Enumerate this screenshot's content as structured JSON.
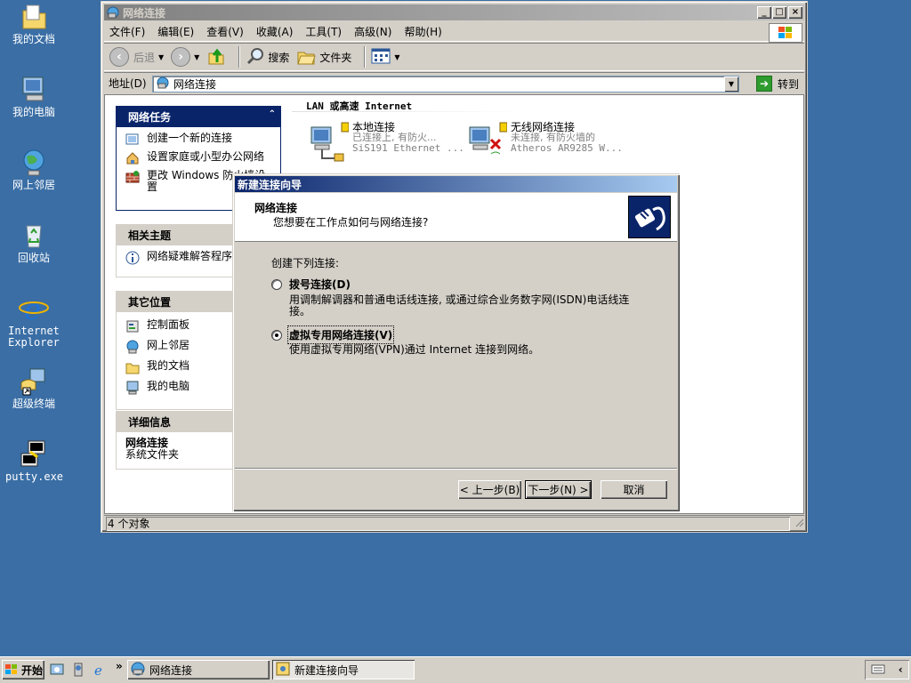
{
  "desktop": {
    "icons": [
      {
        "label": "我的文档"
      },
      {
        "label": "我的电脑"
      },
      {
        "label": "网上邻居"
      },
      {
        "label": "回收站"
      },
      {
        "label": "Internet Explorer"
      },
      {
        "label": "超级终端"
      },
      {
        "label": "putty.exe"
      }
    ]
  },
  "explorer": {
    "title": "网络连接",
    "menu": [
      "文件(F)",
      "编辑(E)",
      "查看(V)",
      "收藏(A)",
      "工具(T)",
      "高级(N)",
      "帮助(H)"
    ],
    "toolbar": {
      "back": "后退",
      "search": "搜索",
      "folders": "文件夹"
    },
    "address": {
      "label": "地址(D)",
      "value": "网络连接",
      "go": "转到"
    },
    "tasks": {
      "network_tasks": {
        "title": "网络任务",
        "items": [
          "创建一个新的连接",
          "设置家庭或小型办公网络",
          "更改 Windows 防火墙设置"
        ]
      },
      "related": {
        "title": "相关主题",
        "items": [
          "网络疑难解答程序"
        ]
      },
      "other_places": {
        "title": "其它位置",
        "items": [
          "控制面板",
          "网上邻居",
          "我的文档",
          "我的电脑"
        ]
      },
      "details": {
        "title": "详细信息",
        "name": "网络连接",
        "type": "系统文件夹"
      }
    },
    "group_title": "LAN 或高速 Internet",
    "connections": [
      {
        "name": "本地连接",
        "status": "已连接上, 有防火...",
        "device": "SiS191 Ethernet ..."
      },
      {
        "name": "无线网络连接",
        "status": "未连接, 有防火墙的",
        "device": "Atheros AR9285 W..."
      }
    ],
    "status": "4 个对象"
  },
  "wizard": {
    "title": "新建连接向导",
    "header_title": "网络连接",
    "header_subtitle": "您想要在工作点如何与网络连接?",
    "prompt": "创建下列连接:",
    "options": [
      {
        "label": "拨号连接(D)",
        "desc": "用调制解调器和普通电话线连接, 或通过综合业务数字网(ISDN)电话线连接。",
        "selected": false
      },
      {
        "label": "虚拟专用网络连接(V)",
        "desc": "使用虚拟专用网络(VPN)通过 Internet 连接到网络。",
        "selected": true
      }
    ],
    "buttons": {
      "back": "< 上一步(B)",
      "next": "下一步(N) >",
      "cancel": "取消"
    }
  },
  "taskbar": {
    "start": "开始",
    "tasks": [
      {
        "label": "网络连接",
        "active": false
      },
      {
        "label": "新建连接向导",
        "active": true
      }
    ]
  }
}
